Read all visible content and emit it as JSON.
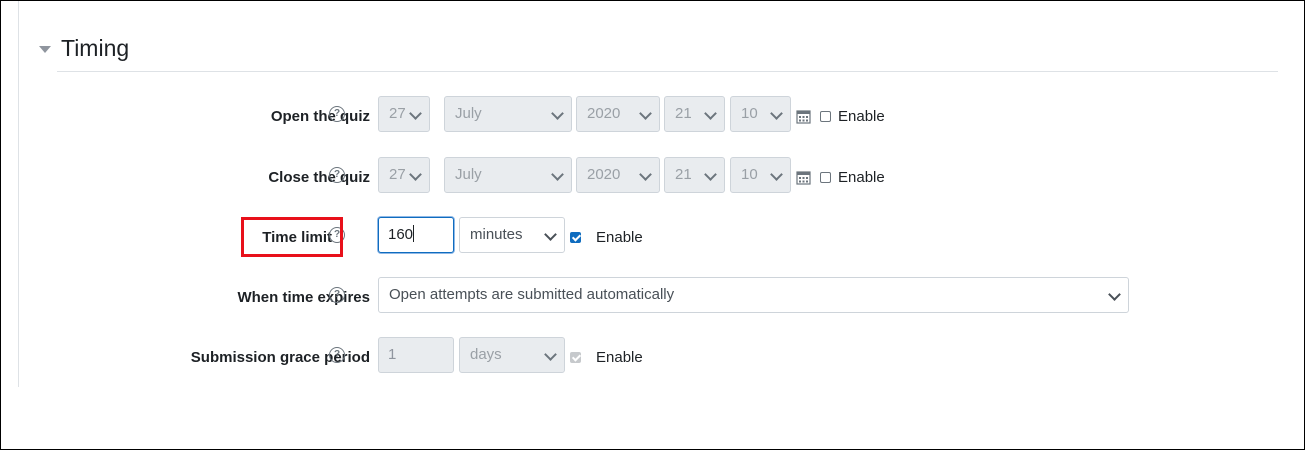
{
  "section": {
    "title": "Timing"
  },
  "open_quiz": {
    "label": "Open the quiz",
    "day": "27",
    "month": "July",
    "year": "2020",
    "hour": "21",
    "minute": "10",
    "enable_label": "Enable",
    "enabled": false
  },
  "close_quiz": {
    "label": "Close the quiz",
    "day": "27",
    "month": "July",
    "year": "2020",
    "hour": "21",
    "minute": "10",
    "enable_label": "Enable",
    "enabled": false
  },
  "time_limit": {
    "label": "Time limit",
    "value": "160",
    "unit": "minutes",
    "enable_label": "Enable",
    "enabled": true
  },
  "when_time_expires": {
    "label": "When time expires",
    "value": "Open attempts are submitted automatically"
  },
  "grace_period": {
    "label": "Submission grace period",
    "value": "1",
    "unit": "days",
    "enable_label": "Enable",
    "enabled": true,
    "disabled": true
  },
  "help_glyph": "?",
  "icons": {
    "help": "question-circle-icon",
    "calendar": "calendar-icon",
    "collapse": "caret-down-icon"
  },
  "colors": {
    "accent": "#0f6cbf",
    "highlight": "#e8101a"
  }
}
